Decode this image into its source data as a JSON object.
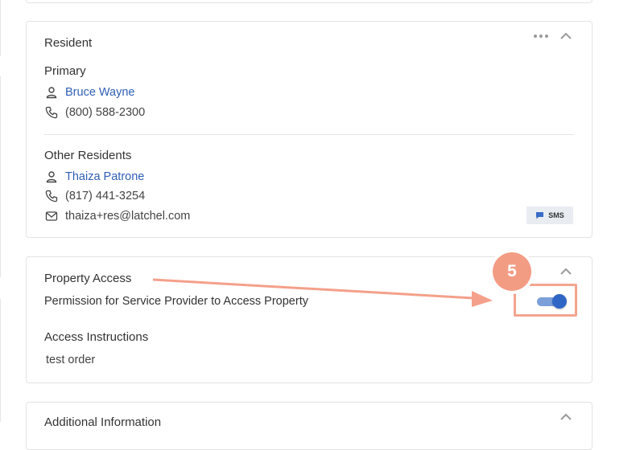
{
  "resident_card": {
    "title": "Resident",
    "primary_label": "Primary",
    "primary": {
      "name": "Bruce Wayne",
      "phone": "(800) 588-2300"
    },
    "other_label": "Other Residents",
    "other": {
      "name": "Thaiza Patrone",
      "phone": "(817) 441-3254",
      "email": "thaiza+res@latchel.com"
    },
    "sms_label": "SMS"
  },
  "property_access_card": {
    "title": "Property Access",
    "permission_label": "Permission for Service Provider to Access Property",
    "permission_enabled": true,
    "instructions_label": "Access Instructions",
    "instructions_value": "test order"
  },
  "additional_card": {
    "title": "Additional Information"
  },
  "annotation": {
    "step_number": "5",
    "accent_color": "#f39c84"
  },
  "icons": {
    "more": "more-dots-icon",
    "collapse": "chevron-up-icon",
    "person": "person-icon",
    "phone": "phone-icon",
    "email": "email-icon",
    "chat": "chat-bubble-icon"
  },
  "colors": {
    "link": "#2f5fb4",
    "toggle_on": "#2f66c6",
    "border": "#e3e3e3"
  }
}
